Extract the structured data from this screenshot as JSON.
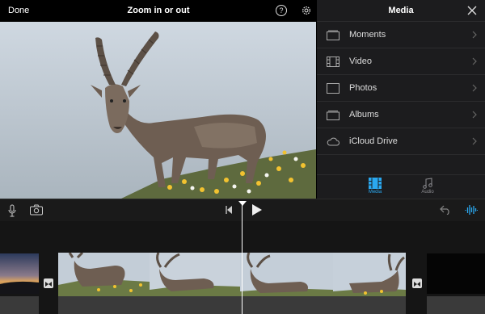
{
  "topbar": {
    "done_label": "Done",
    "title": "Zoom in or out",
    "help_label": "?"
  },
  "media": {
    "title": "Media",
    "items": [
      {
        "label": "Moments",
        "icon": "moments-icon"
      },
      {
        "label": "Video",
        "icon": "film-icon"
      },
      {
        "label": "Photos",
        "icon": "photo-icon"
      },
      {
        "label": "Albums",
        "icon": "albums-icon"
      },
      {
        "label": "iCloud Drive",
        "icon": "cloud-icon"
      }
    ],
    "tabs": [
      {
        "label": "Media",
        "selected": true
      },
      {
        "label": "Audio",
        "selected": false
      }
    ]
  },
  "colors": {
    "accent": "#2aa8f0",
    "panel": "#1c1c1e"
  }
}
